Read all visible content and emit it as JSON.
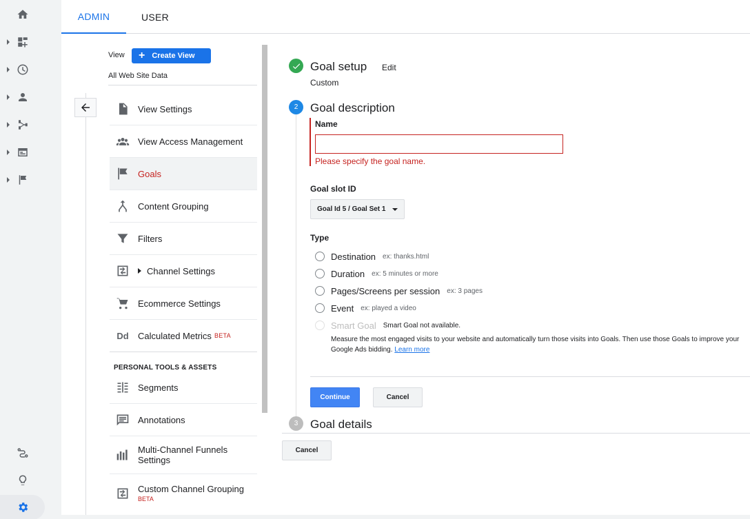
{
  "tabs": {
    "admin": "ADMIN",
    "user": "USER"
  },
  "rail": {
    "icons": [
      "home-icon",
      "customization-icon",
      "realtime-icon",
      "audience-icon",
      "acquisition-icon",
      "behavior-icon",
      "conversions-icon",
      "attribution-icon",
      "discover-icon",
      "admin-gear-icon"
    ]
  },
  "view": {
    "label": "View",
    "create_button": "Create View",
    "selected": "All Web Site Data"
  },
  "menu": {
    "items": [
      {
        "label": "View Settings",
        "icon": "document-icon"
      },
      {
        "label": "View Access Management",
        "icon": "people-icon"
      },
      {
        "label": "Goals",
        "icon": "flag-icon",
        "active": true
      },
      {
        "label": "Content Grouping",
        "icon": "grouping-icon"
      },
      {
        "label": "Filters",
        "icon": "filter-icon"
      },
      {
        "label": "Channel Settings",
        "icon": "channel-icon"
      },
      {
        "label": "Ecommerce Settings",
        "icon": "cart-icon"
      },
      {
        "label": "Calculated Metrics",
        "badge": "BETA",
        "icon": "dd-icon"
      }
    ],
    "section_header": "PERSONAL TOOLS & ASSETS",
    "personal_items": [
      {
        "label": "Segments",
        "icon": "segments-icon"
      },
      {
        "label": "Annotations",
        "icon": "annotation-icon"
      },
      {
        "label": "Multi-Channel Funnels Settings",
        "icon": "funnel-bars-icon"
      },
      {
        "label": "Custom Channel Grouping",
        "badge": "BETA",
        "icon": "channel-icon"
      }
    ]
  },
  "goal": {
    "setup": {
      "title": "Goal setup",
      "edit": "Edit",
      "value": "Custom"
    },
    "description": {
      "step": "2",
      "title": "Goal description",
      "name_label": "Name",
      "name_value": "",
      "name_error": "Please specify the goal name.",
      "slot_label": "Goal slot ID",
      "slot_value": "Goal Id 5 / Goal Set 1",
      "type_label": "Type",
      "types": [
        {
          "label": "Destination",
          "example": "ex: thanks.html"
        },
        {
          "label": "Duration",
          "example": "ex: 5 minutes or more"
        },
        {
          "label": "Pages/Screens per session",
          "example": "ex: 3 pages"
        },
        {
          "label": "Event",
          "example": "ex: played a video"
        },
        {
          "label": "Smart Goal",
          "example": "Smart Goal not available.",
          "disabled": true
        }
      ],
      "smart_desc": "Measure the most engaged visits to your website and automatically turn those visits into Goals. Then use those Goals to improve your Google Ads bidding.",
      "learn_more": "Learn more",
      "continue": "Continue",
      "cancel": "Cancel"
    },
    "details": {
      "step": "3",
      "title": "Goal details"
    },
    "cancel": "Cancel"
  },
  "colors": {
    "accent": "#1a73e8",
    "error": "#c5221f",
    "success": "#34a853"
  }
}
